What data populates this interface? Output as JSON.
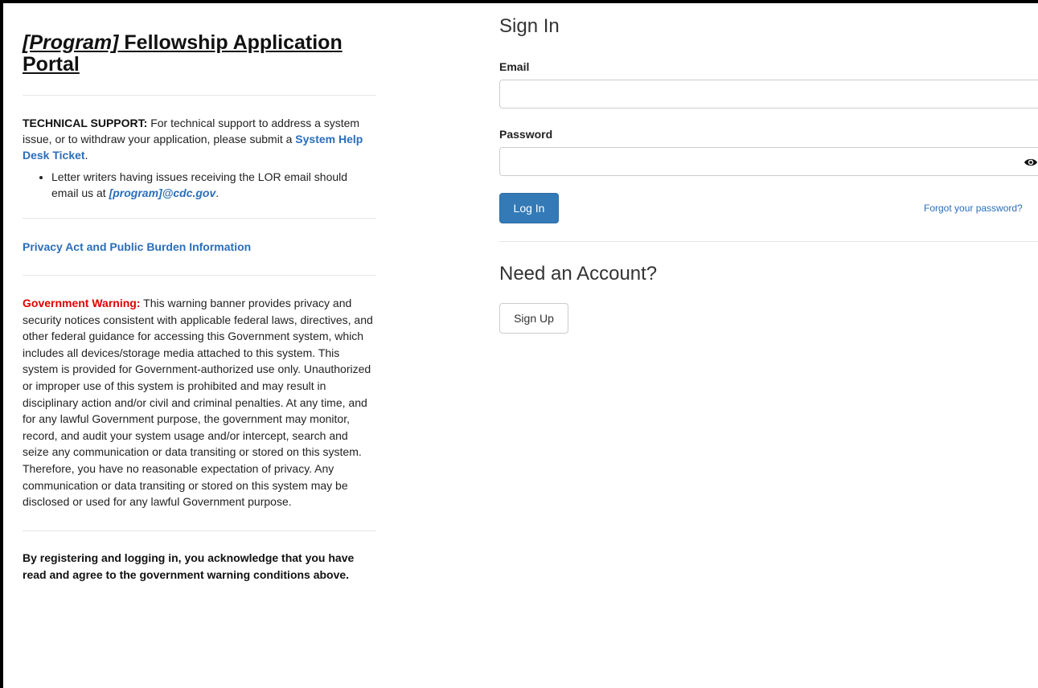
{
  "left": {
    "title_program": "[Program]",
    "title_rest": " Fellowship Application Portal",
    "support": {
      "label": "TECHNICAL SUPPORT:",
      "text": " For technical support to address a system issue, or to withdraw your application, please submit a ",
      "link": "System Help Desk Ticket",
      "after_link": ".",
      "bullet_text": "Letter writers having issues receiving the LOR email should email us at ",
      "bullet_email": "[program]@cdc.gov",
      "bullet_after": "."
    },
    "privacy_link": "Privacy Act and Public Burden Information",
    "warning": {
      "label": "Government Warning:",
      "text": " This warning banner provides privacy and security notices consistent with applicable federal laws, directives, and other federal guidance for accessing this Government system, which includes all devices/storage media attached to this system. This system is provided for Government-authorized use only. Unauthorized or improper use of this system is prohibited and may result in disciplinary action and/or civil and criminal penalties. At any time, and for any lawful Government purpose, the government may monitor, record, and audit your system usage and/or intercept, search and seize any communication or data transiting or stored on this system. Therefore, you have no reasonable expectation of privacy. Any communication or data transiting or stored on this system may be disclosed or used for any lawful Government purpose."
    },
    "acknowledgement": "By registering and logging in, you acknowledge that you have read and agree to the government warning conditions above."
  },
  "signin": {
    "title": "Sign In",
    "email_label": "Email",
    "email_value": "",
    "password_label": "Password",
    "password_value": "",
    "show_password_icon": "eye-icon",
    "login_button": "Log In",
    "forgot_link": "Forgot your password?"
  },
  "account": {
    "title": "Need an Account?",
    "signup_button": "Sign Up"
  },
  "colors": {
    "link": "#2a6ebb",
    "primary_button": "#337ab7",
    "warning_label": "#e00000"
  }
}
